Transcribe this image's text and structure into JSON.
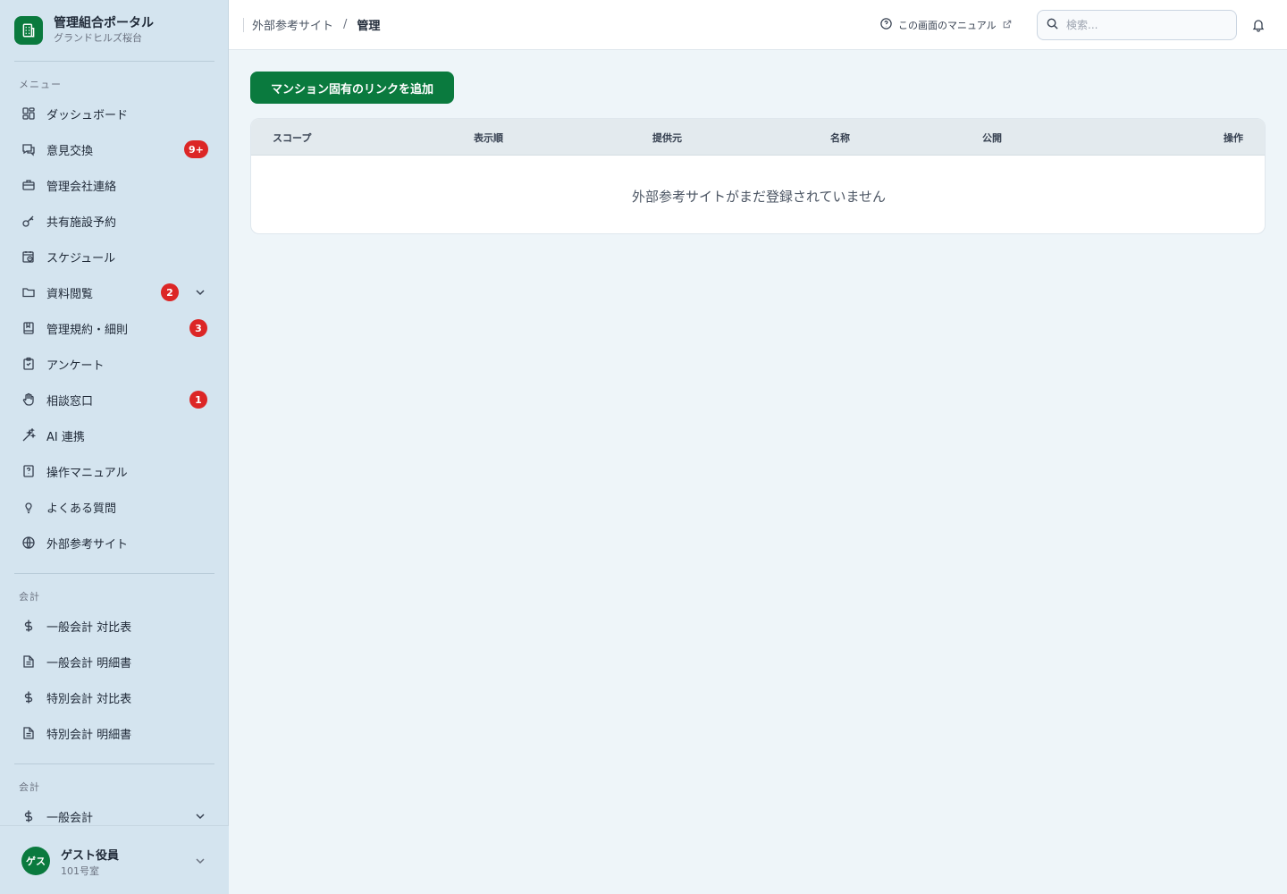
{
  "brand": {
    "title": "管理組合ポータル",
    "subtitle": "グランドヒルズ桜台"
  },
  "sidebar": {
    "section_menu": "メニュー",
    "items": [
      {
        "label": "ダッシュボード",
        "icon": "dashboard-icon"
      },
      {
        "label": "意見交換",
        "icon": "chat-icon",
        "badge": "9+"
      },
      {
        "label": "管理会社連絡",
        "icon": "briefcase-icon"
      },
      {
        "label": "共有施設予約",
        "icon": "key-icon"
      },
      {
        "label": "スケジュール",
        "icon": "calendar-clock-icon"
      },
      {
        "label": "資料閲覧",
        "icon": "folder-icon",
        "badge": "2",
        "expandable": true
      },
      {
        "label": "管理規約・細則",
        "icon": "book-icon",
        "badge": "3"
      },
      {
        "label": "アンケート",
        "icon": "clipboard-icon"
      },
      {
        "label": "相談窓口",
        "icon": "hand-icon",
        "badge": "1"
      },
      {
        "label": "AI 連携",
        "icon": "sparkle-icon"
      },
      {
        "label": "操作マニュアル",
        "icon": "manual-icon"
      },
      {
        "label": "よくある質問",
        "icon": "lightbulb-icon"
      },
      {
        "label": "外部参考サイト",
        "icon": "globe-icon"
      }
    ],
    "section_accounting": "会計",
    "accounting_items": [
      {
        "label": "一般会計 対比表",
        "icon": "dollar-icon"
      },
      {
        "label": "一般会計 明細書",
        "icon": "document-icon"
      },
      {
        "label": "特別会計 対比表",
        "icon": "dollar-icon"
      },
      {
        "label": "特別会計 明細書",
        "icon": "document-icon"
      }
    ],
    "section_accounting2": "会計",
    "accounting2_items": [
      {
        "label": "一般会計",
        "icon": "dollar-icon",
        "expandable": true
      }
    ]
  },
  "user": {
    "avatar_text": "ゲス",
    "name": "ゲスト役員",
    "room": "101号室"
  },
  "header": {
    "breadcrumb": [
      "外部参考サイト",
      "管理"
    ],
    "breadcrumb_sep": "/",
    "manual_link": "この画面のマニュアル",
    "search_placeholder": "検索..."
  },
  "main": {
    "add_button": "マンション固有のリンクを追加",
    "table": {
      "columns": [
        "スコープ",
        "表示順",
        "提供元",
        "名称",
        "公開",
        "操作"
      ],
      "rows": [],
      "empty_message": "外部参考サイトがまだ登録されていません"
    }
  },
  "colors": {
    "accent": "#0a7a3e",
    "badge": "#dc2626",
    "sidebar_bg": "#d4e4ef",
    "page_bg": "#eef5f9"
  }
}
